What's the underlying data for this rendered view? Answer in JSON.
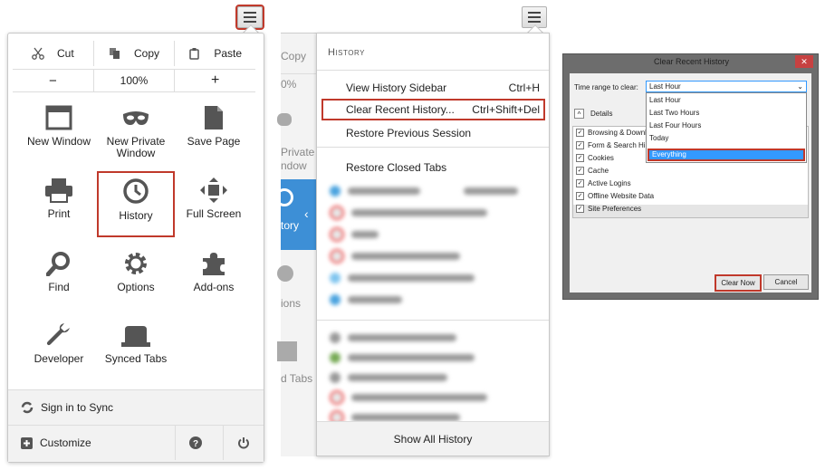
{
  "panel1": {
    "edit": {
      "cut": "Cut",
      "copy": "Copy",
      "paste": "Paste"
    },
    "zoom": {
      "minus": "−",
      "level": "100%",
      "plus": "+"
    },
    "tiles": [
      {
        "label": "New Window",
        "icon": "window-icon"
      },
      {
        "label": "New Private Window",
        "icon": "mask-icon"
      },
      {
        "label": "Save Page",
        "icon": "page-icon"
      },
      {
        "label": "Print",
        "icon": "printer-icon"
      },
      {
        "label": "History",
        "icon": "clock-icon"
      },
      {
        "label": "Full Screen",
        "icon": "fullscreen-icon"
      },
      {
        "label": "Find",
        "icon": "magnifier-icon"
      },
      {
        "label": "Options",
        "icon": "gear-icon"
      },
      {
        "label": "Add-ons",
        "icon": "puzzle-icon"
      },
      {
        "label": "Developer",
        "icon": "wrench-icon"
      },
      {
        "label": "Synced Tabs",
        "icon": "synced-tabs-icon"
      }
    ],
    "sync": "Sign in to Sync",
    "customize": "Customize"
  },
  "panel2": {
    "behind": {
      "copy": "Copy",
      "zoom": "0%",
      "private": "Private",
      "window": "ndow",
      "history": "tory",
      "options": "ions",
      "tabs": "d Tabs"
    },
    "header": "History",
    "items": [
      {
        "label": "View History Sidebar",
        "shortcut": "Ctrl+H"
      },
      {
        "label": "Clear Recent History...",
        "shortcut": "Ctrl+Shift+Del"
      },
      {
        "label": "Restore Previous Session",
        "shortcut": ""
      },
      {
        "label": "Restore Closed Tabs",
        "shortcut": ""
      }
    ],
    "show_all": "Show All History"
  },
  "dialog": {
    "title": "Clear Recent History",
    "time_range_label": "Time range to clear:",
    "selected": "Last Hour",
    "options": [
      "Last Hour",
      "Last Two Hours",
      "Last Four Hours",
      "Today",
      "Everything"
    ],
    "details": "Details",
    "checks": [
      "Browsing & Download History",
      "Form & Search History",
      "Cookies",
      "Cache",
      "Active Logins",
      "Offline Website Data",
      "Site Preferences"
    ],
    "clear_now": "Clear Now",
    "cancel": "Cancel",
    "close": "✕"
  },
  "colors": {
    "highlight": "#c0392b",
    "selection": "#3399ff",
    "sidebar_active": "#3d8fd6"
  }
}
